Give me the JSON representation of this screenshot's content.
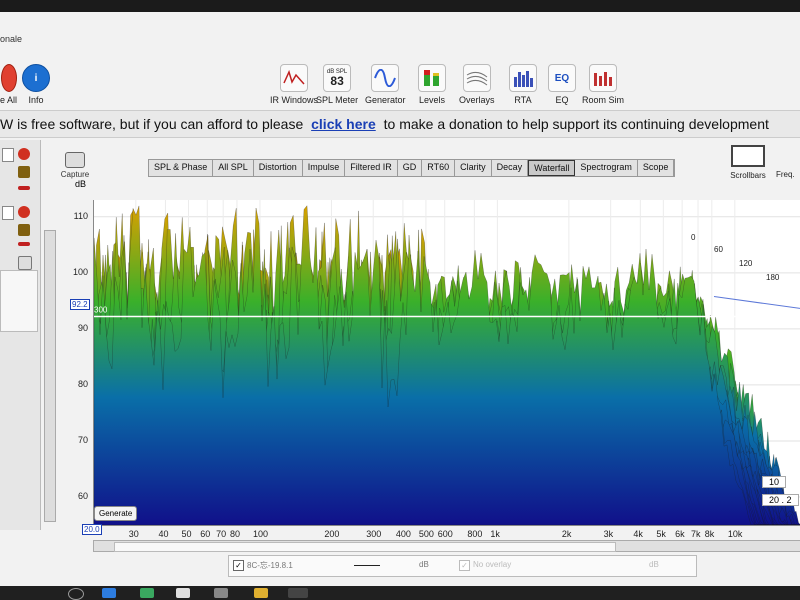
{
  "window": {
    "title_fragment": "onale"
  },
  "left_toolbar": {
    "remove_all_label": "e All",
    "info_label": "Info"
  },
  "toolbar": [
    {
      "label": "IR Windows",
      "icon": "ir-windows-icon"
    },
    {
      "label": "SPL Meter",
      "icon": "spl-meter-icon",
      "display_top": "dB SPL",
      "display_value": "83"
    },
    {
      "label": "Generator",
      "icon": "generator-icon"
    },
    {
      "label": "Levels",
      "icon": "levels-icon"
    },
    {
      "label": "Overlays",
      "icon": "overlays-icon"
    },
    {
      "label": "RTA",
      "icon": "rta-icon"
    },
    {
      "label": "EQ",
      "icon": "eq-icon",
      "display_value": "EQ"
    },
    {
      "label": "Room Sim",
      "icon": "room-sim-icon"
    }
  ],
  "banner": {
    "text_before": "W is free software, but if you can afford to please",
    "link": "click here",
    "text_after": "to make a donation to help support its continuing development"
  },
  "capture": {
    "label": "Capture"
  },
  "tabs": [
    "SPL & Phase",
    "All SPL",
    "Distortion",
    "Impulse",
    "Filtered IR",
    "GD",
    "RT60",
    "Clarity",
    "Decay",
    "Waterfall",
    "Spectrogram",
    "Scope"
  ],
  "active_tab": "Waterfall",
  "right_controls": {
    "scrollbars_label": "Scrollbars",
    "freq_label": "Freq."
  },
  "chart_data": {
    "type": "area",
    "ylabel": "dB",
    "y_ticks": [
      "110",
      "100",
      "90",
      "80",
      "70",
      "60"
    ],
    "ylim": [
      55,
      113
    ],
    "x_ticks": [
      "30",
      "40",
      "50",
      "60",
      "70",
      "80",
      "100",
      "200",
      "300",
      "400",
      "500",
      "600",
      "800",
      "1k",
      "2k",
      "3k",
      "4k",
      "5k",
      "6k",
      "7k",
      "8k",
      "10k"
    ],
    "x_min_box": "20.0",
    "y_marker_box": "92.2",
    "y_marker_value": 92.2,
    "time_labels": [
      "0",
      "60",
      "120",
      "180"
    ],
    "plot_label_300": "300",
    "range_box_1": "10",
    "range_box_2": "20 . 2",
    "colors": {
      "top": "#d8a000",
      "mid": "#3ab02a",
      "low": "#0a6fa8",
      "base": "#10108a"
    }
  },
  "generate_button": "Generate",
  "legend": {
    "measurement_name": "8C-忘-19.8.1",
    "unit": "dB",
    "overlay_text": "No overlay",
    "overlay_unit": "dB"
  }
}
